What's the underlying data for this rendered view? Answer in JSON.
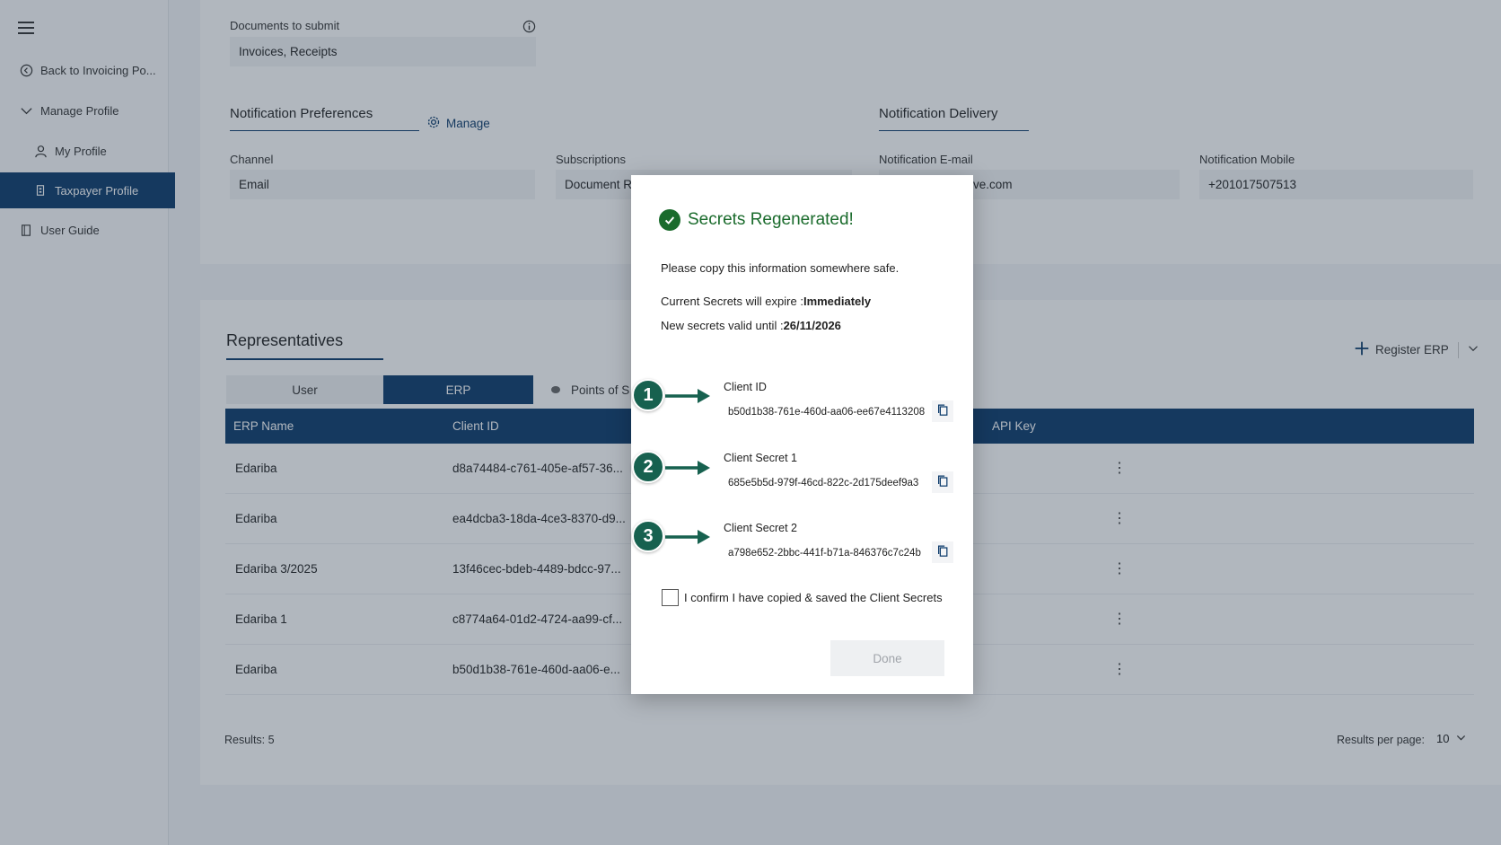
{
  "sidebar": {
    "items": [
      {
        "label": "Back to Invoicing Po..."
      },
      {
        "label": "Manage Profile"
      },
      {
        "label": "My Profile"
      },
      {
        "label": "Taxpayer Profile"
      },
      {
        "label": "User Guide"
      }
    ]
  },
  "profile": {
    "documents_label": "Documents to submit",
    "documents_value": "Invoices, Receipts",
    "notif_pref_title": "Notification Preferences",
    "manage_label": "Manage",
    "notif_delivery_title": "Notification Delivery",
    "channel_label": "Channel",
    "channel_value": "Email",
    "subscriptions_label": "Subscriptions",
    "subscriptions_value": "Document Re",
    "email_label": "Notification E-mail",
    "email_value": "ive.com",
    "mobile_label": "Notification Mobile",
    "mobile_value": "+201017507513"
  },
  "representatives": {
    "title": "Representatives",
    "register_label": "Register ERP",
    "tabs": [
      "User",
      "ERP",
      "Points of S"
    ],
    "columns": [
      "ERP Name",
      "Client ID",
      "API Key"
    ],
    "rows": [
      {
        "name": "Edariba",
        "client_id": "d8a74484-c761-405e-af57-36..."
      },
      {
        "name": "Edariba",
        "client_id": "ea4dcba3-18da-4ce3-8370-d9..."
      },
      {
        "name": "Edariba 3/2025",
        "client_id": "13f46cec-bdeb-4489-bdcc-97..."
      },
      {
        "name": "Edariba 1",
        "client_id": "c8774a64-01d2-4724-aa99-cf..."
      },
      {
        "name": "Edariba",
        "client_id": "b50d1b38-761e-460d-aa06-e..."
      }
    ],
    "results_text": "Results: 5",
    "per_page_label": "Results per page:",
    "per_page_value": "10"
  },
  "modal": {
    "title": "Secrets Regenerated!",
    "instruction": "Please copy this information somewhere safe.",
    "expire_label": "Current Secrets will expire :",
    "expire_value": "Immediately",
    "valid_label": "New secrets valid until :",
    "valid_value": "26/11/2026",
    "client_id_label": "Client ID",
    "client_id_value": "b50d1b38-761e-460d-aa06-ee67e4113208",
    "secret1_label": "Client Secret 1",
    "secret1_value": "685e5b5d-979f-46cd-822c-2d175deef9a3",
    "secret2_label": "Client Secret 2",
    "secret2_value": "a798e652-2bbc-441f-b71a-846376c7c24b",
    "confirm_label": "I confirm I have copied & saved the Client Secrets",
    "done_label": "Done"
  },
  "steps": [
    "1",
    "2",
    "3"
  ],
  "colors": {
    "primary": "#0b3a6b",
    "success": "#1a6b2c",
    "step": "#17614f"
  }
}
